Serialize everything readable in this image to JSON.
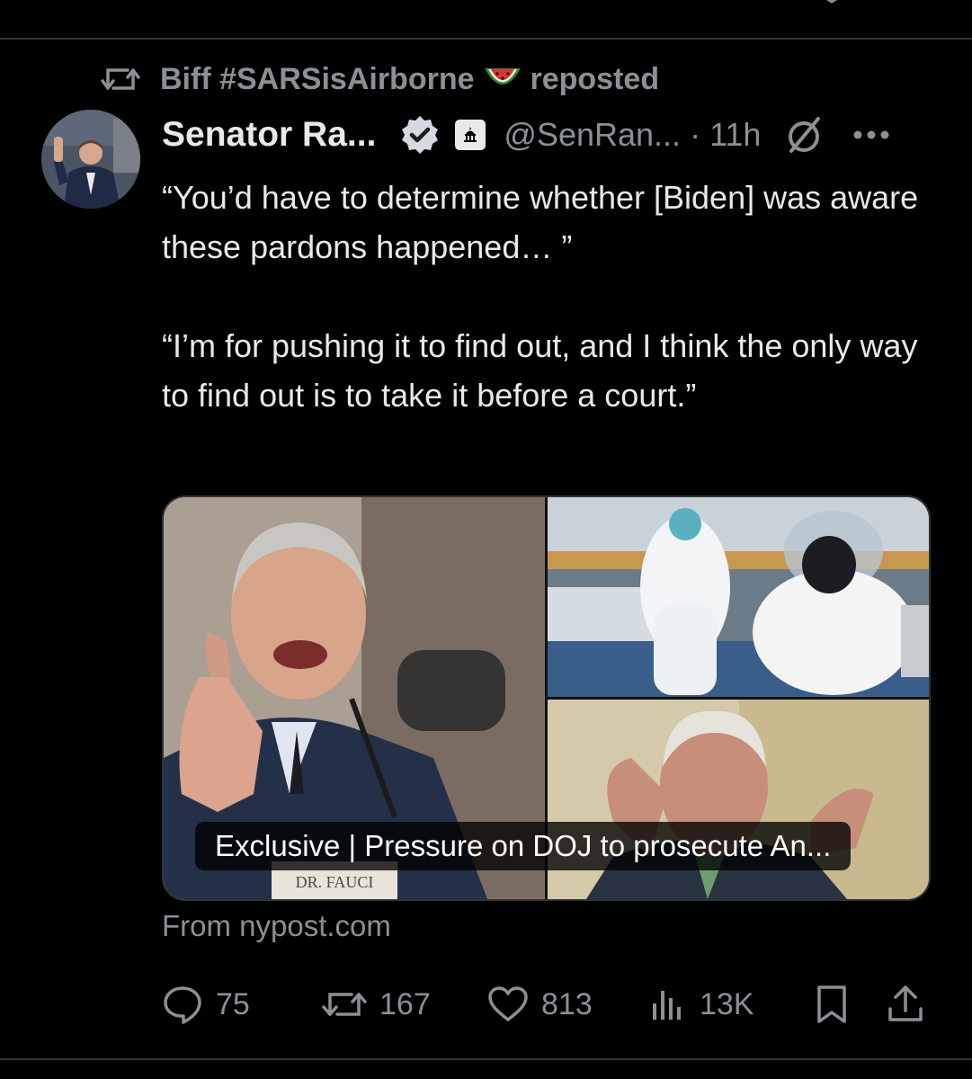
{
  "repost": {
    "user": "Biff #SARSisAirborne",
    "emoji": "watermelon",
    "label": "reposted"
  },
  "tweet": {
    "display_name": "Senator Ra...",
    "handle": "@SenRan...",
    "separator": "·",
    "time": "11h",
    "paragraph1": "“You’d have to determine whether [Biden] was aware these pardons happened… ”",
    "paragraph2": "“I’m for pushing it to find out, and I think the only way to find out is to take it before a court.”"
  },
  "card": {
    "caption": "Exclusive | Pressure on DOJ to prosecute An...",
    "nameplate": "DR. FAUCI",
    "source": "From nypost.com"
  },
  "actions": {
    "replies": "75",
    "reposts": "167",
    "likes": "813",
    "views": "13K"
  },
  "colors": {
    "background": "#000000",
    "text": "#e7e9ea",
    "muted": "#8b9096",
    "verified": "#1d9bf0",
    "divider": "#2f3336"
  },
  "icons": [
    "repost-icon",
    "watermelon-icon",
    "verified-icon",
    "government-badge-icon",
    "grok-icon",
    "more-icon",
    "reply-icon",
    "retweet-icon",
    "like-icon",
    "views-icon",
    "bookmark-icon",
    "share-icon"
  ]
}
